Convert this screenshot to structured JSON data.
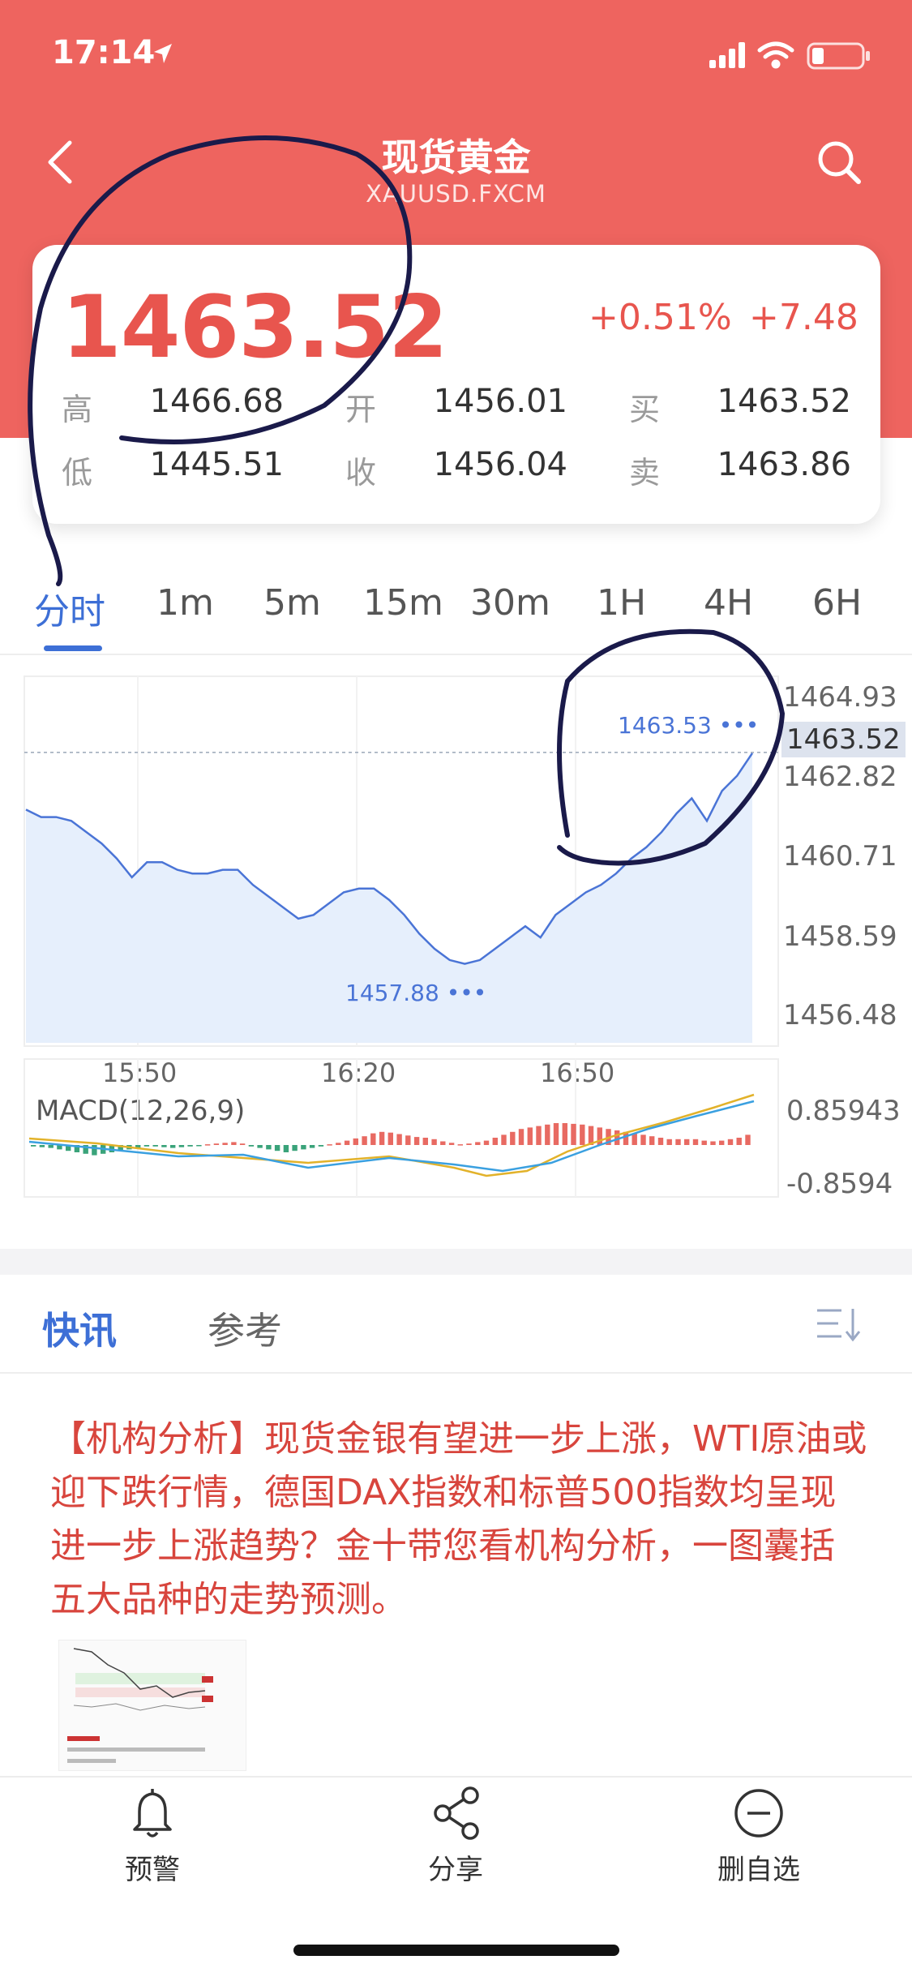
{
  "status": {
    "time": "17:14"
  },
  "header": {
    "title": "现货黄金",
    "subtitle": "XAUUSD.FXCM"
  },
  "quote": {
    "price": "1463.52",
    "change_percent": "+0.51%",
    "change": "+7.48",
    "high_label": "高",
    "high": "1466.68",
    "open_label": "开",
    "open": "1456.01",
    "bid_label": "买",
    "bid": "1463.52",
    "low_label": "低",
    "low": "1445.51",
    "close_label": "收",
    "close": "1456.04",
    "ask_label": "卖",
    "ask": "1463.86"
  },
  "tabs": [
    "分时",
    "1m",
    "5m",
    "15m",
    "30m",
    "1H",
    "4H",
    "6H"
  ],
  "active_tab": "分时",
  "chart_data": [
    {
      "type": "area",
      "x_ticks": [
        "15:50",
        "16:20",
        "16:50"
      ],
      "y_ticks": [
        "1464.93",
        "1462.82",
        "1460.71",
        "1458.59",
        "1456.48"
      ],
      "current_price_tag": "1463.52",
      "max_annotation": "1463.53",
      "min_annotation": "1457.88",
      "ylim": [
        1455.8,
        1465.5
      ],
      "series": [
        {
          "values": [
            1462.0,
            1461.8,
            1461.8,
            1461.7,
            1461.4,
            1461.1,
            1460.7,
            1460.2,
            1460.6,
            1460.6,
            1460.4,
            1460.3,
            1460.3,
            1460.4,
            1460.4,
            1460.0,
            1459.7,
            1459.4,
            1459.1,
            1459.2,
            1459.5,
            1459.8,
            1459.9,
            1459.9,
            1459.6,
            1459.2,
            1458.7,
            1458.3,
            1458.0,
            1457.9,
            1458.0,
            1458.3,
            1458.6,
            1458.9,
            1458.6,
            1459.2,
            1459.5,
            1459.8,
            1460.0,
            1460.3,
            1460.7,
            1461.0,
            1461.4,
            1461.9,
            1462.3,
            1461.7,
            1462.5,
            1462.9,
            1463.5
          ]
        }
      ]
    },
    {
      "type": "bar",
      "title": "MACD(12,26,9)",
      "y_ticks": [
        "0.85943",
        "-0.8594"
      ]
    }
  ],
  "news": {
    "tabs": [
      "快讯",
      "参考"
    ],
    "headline": "【机构分析】现货金银有望进一步上涨，WTI原油或迎下跌行情，德国DAX指数和标普500指数均呈现进一步上涨趋势？金十带您看机构分析，一图囊括五大品种的走势预测。"
  },
  "bottom_bar": [
    {
      "label": "预警",
      "icon": "bell-icon"
    },
    {
      "label": "分享",
      "icon": "share-icon"
    },
    {
      "label": "删自选",
      "icon": "remove-circle-icon"
    }
  ]
}
